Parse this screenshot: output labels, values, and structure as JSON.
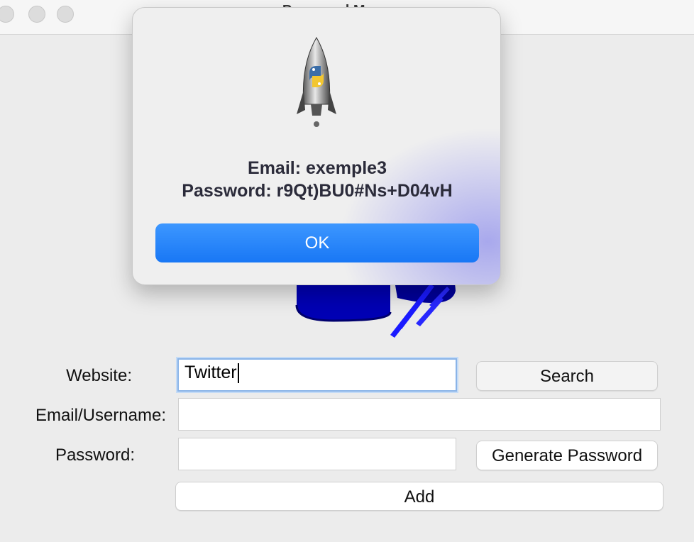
{
  "window": {
    "title": "Password Manager"
  },
  "form": {
    "website_label": "Website:",
    "website_value": "Twitter",
    "email_label": "Email/Username:",
    "email_value": "",
    "password_label": "Password:",
    "password_value": "",
    "search_button": "Search",
    "generate_button": "Generate Password",
    "add_button": "Add"
  },
  "dialog": {
    "icon": "python-launcher-rocket-icon",
    "line1": "Email: exemple3",
    "line2": "Password: r9Qt)BU0#Ns+D04vH",
    "ok_button": "OK"
  },
  "colors": {
    "accent": "#1877f5",
    "logo_blue": "#0000cc"
  }
}
